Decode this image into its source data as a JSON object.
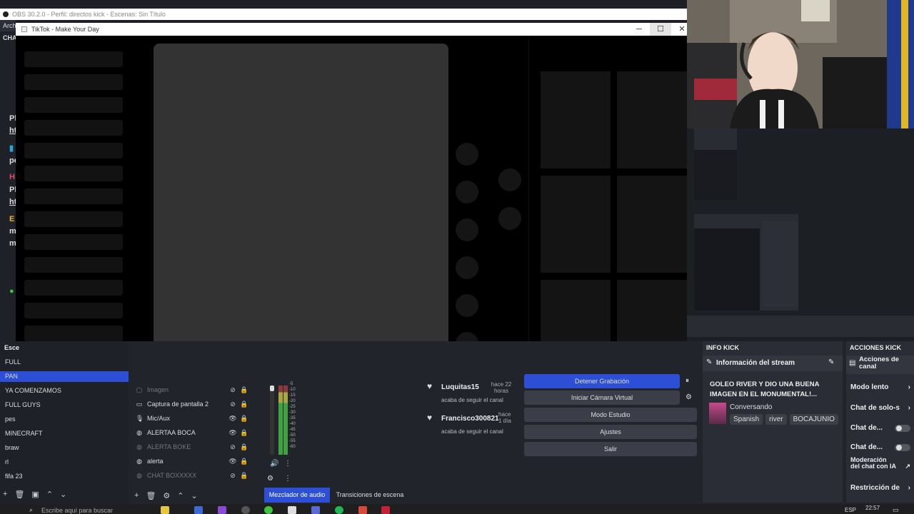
{
  "obs": {
    "title": "OBS 30.2.0 - Perfil: directos kick - Escenas: Sin Título",
    "menu_first": "Arch",
    "left_label": "CHA"
  },
  "tiktok": {
    "title": "TikTok - Make Your Day",
    "minimize": "─",
    "maximize": "☐",
    "close": "✕"
  },
  "scenes": {
    "header": "Esce",
    "items": [
      "FULL",
      "PAN",
      "YA COMENZAMOS",
      "FULL GUYS",
      "pes",
      "MINECRAFT",
      "braw",
      "rl",
      "fifa 23"
    ]
  },
  "sources": {
    "items": [
      {
        "label": "Imagen",
        "icon": "image-icon",
        "dim": true
      },
      {
        "label": "Captura de pantalla 2",
        "icon": "monitor-icon",
        "dim": false
      },
      {
        "label": "Mic/Aux",
        "icon": "mic-icon",
        "dim": false
      },
      {
        "label": "ALERTAA BOCA",
        "icon": "globe-icon",
        "dim": false
      },
      {
        "label": "ALERTA BOKE",
        "icon": "globe-icon",
        "dim": true
      },
      {
        "label": "alerta",
        "icon": "globe-icon",
        "dim": false
      },
      {
        "label": "CHAT BOXXXXX",
        "icon": "globe-icon",
        "dim": true
      }
    ]
  },
  "mixer": {
    "scale": [
      "-5",
      "-10",
      "-15",
      "-20",
      "-25",
      "-30",
      "-35",
      "-40",
      "-45",
      "-50",
      "-55",
      "-60"
    ]
  },
  "tabs": {
    "mixer": "Mezclador de audio",
    "transitions": "Transiciones de escena"
  },
  "events": [
    {
      "user": "Luquitas15",
      "action": "acaba de seguir el canal",
      "time": "hace 22 horas"
    },
    {
      "user": "Francisco300821",
      "action": "acaba de seguir el canal",
      "time": "hace 1 día"
    }
  ],
  "controls": {
    "stop_recording": "Detener Grabación",
    "virtual_cam": "Iniciar Cámara Virtual",
    "studio_mode": "Modo Estudio",
    "settings": "Ajustes",
    "exit": "Salir"
  },
  "info_kick": {
    "header": "INFO KICK",
    "section": "Información del stream",
    "stream_title": "GOLEO RIVER Y DIO UNA BUENA IMAGEN EN EL MONUMENTAL!...",
    "category": "Conversando",
    "tags": [
      "Spanish",
      "river",
      "BOCAJUNIO"
    ]
  },
  "acciones_kick": {
    "header": "ACCIONES KICK",
    "section": "Acciones de canal",
    "items": [
      "Modo lento",
      "Chat de solo-s",
      "Chat de...",
      "Chat de...",
      "Moderación del chat con IA",
      "Restricción de"
    ]
  },
  "taskbar": {
    "search_placeholder": "Escribe aquí para buscar",
    "time": "22:57",
    "lang": "ESP"
  },
  "colors": {
    "obs_bg": "#1e1f24",
    "accent": "#2c4fd6",
    "panel": "#2a2c36",
    "meter_green": "#3ea33e"
  }
}
